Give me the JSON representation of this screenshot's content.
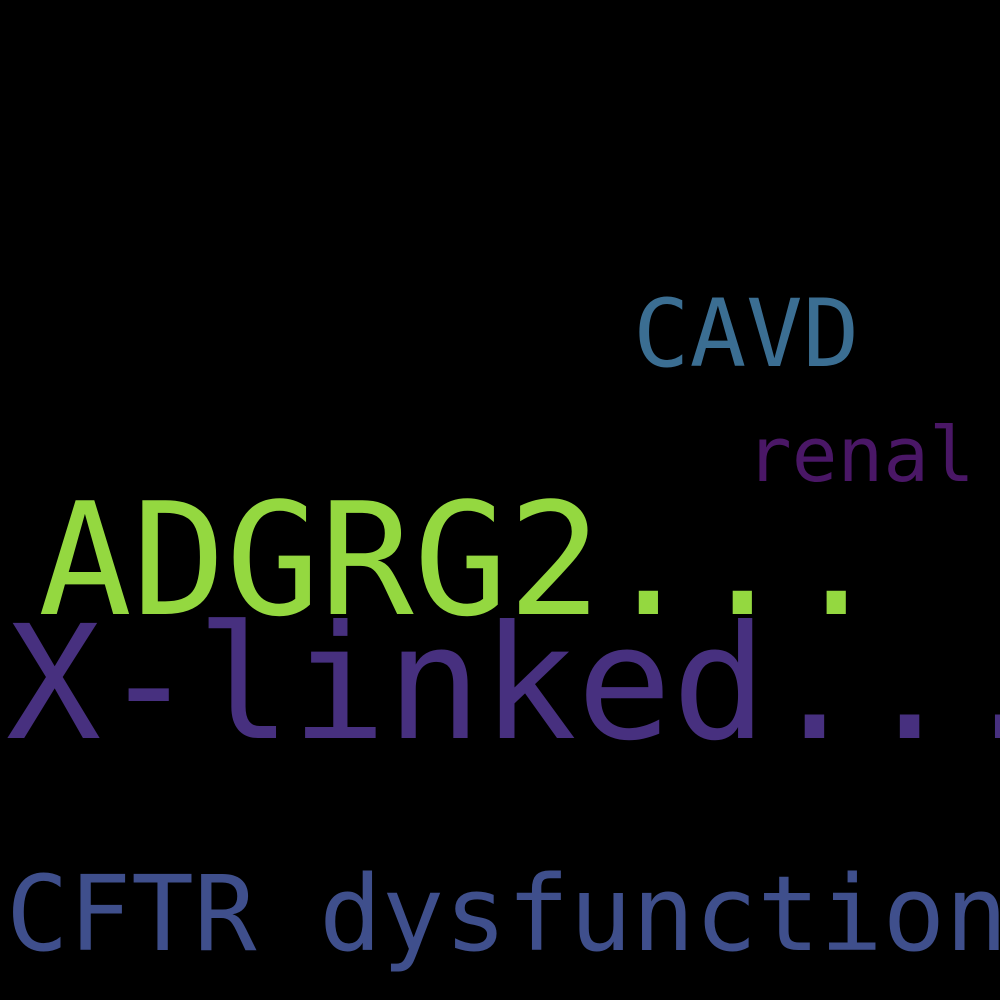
{
  "word_cloud": {
    "background_color": "#000000",
    "words": [
      {
        "id": "cavd",
        "text": "CAVD",
        "color": "#3b6e92"
      },
      {
        "id": "renal",
        "text": "renal",
        "color": "#4a1766"
      },
      {
        "id": "adgrg2",
        "text": "ADGRG2...",
        "color": "#94d840"
      },
      {
        "id": "xlinked",
        "text": "X-linked...",
        "color": "#47307f"
      },
      {
        "id": "cftr",
        "text": "CFTR dysfunction",
        "color": "#3f4f8c"
      }
    ]
  }
}
